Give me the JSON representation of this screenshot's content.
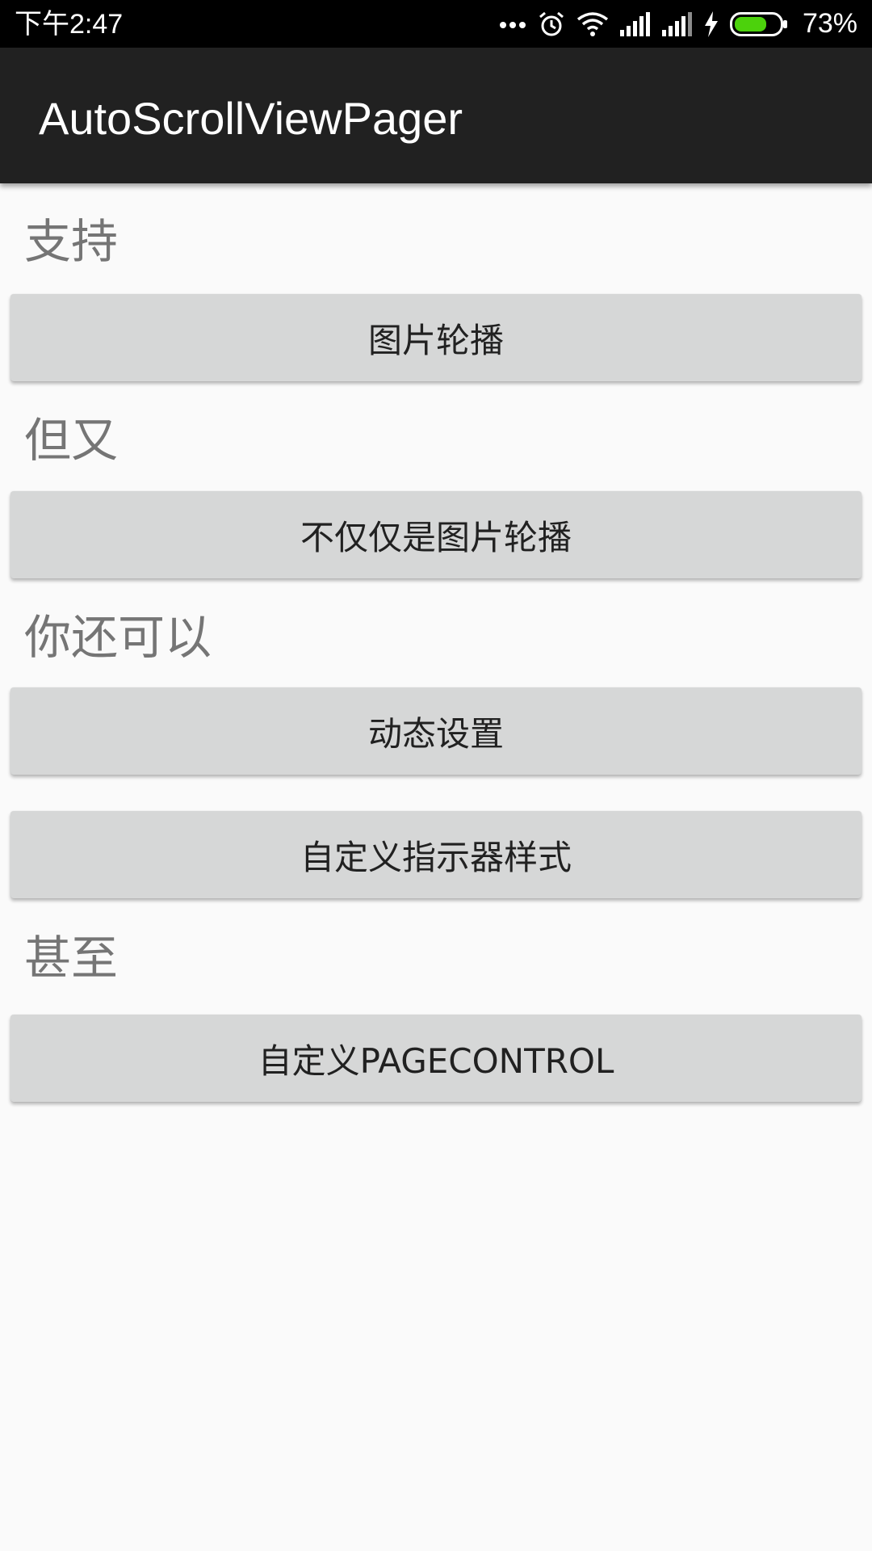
{
  "status_bar": {
    "time": "下午2:47",
    "battery_percent": "73%",
    "battery_level": 0.73,
    "icons": [
      "more-dots-icon",
      "alarm-icon",
      "wifi-icon",
      "signal-icon",
      "signal-icon",
      "charging-icon",
      "battery-icon"
    ]
  },
  "app_bar": {
    "title": "AutoScrollViewPager"
  },
  "sections": [
    {
      "label": "支持"
    },
    {
      "label": "但又"
    },
    {
      "label": "你还可以"
    },
    {
      "label": "甚至"
    }
  ],
  "buttons": [
    {
      "label": "图片轮播"
    },
    {
      "label": "不仅仅是图片轮播"
    },
    {
      "label": "动态设置"
    },
    {
      "label": "自定义指示器样式"
    },
    {
      "label": "自定义PAGECONTROL"
    }
  ],
  "colors": {
    "status_bar_bg": "#000000",
    "app_bar_bg": "#212121",
    "page_bg": "#fafafa",
    "button_bg": "#d6d7d7",
    "section_label": "#757575",
    "battery_fill": "#4cd20c"
  }
}
